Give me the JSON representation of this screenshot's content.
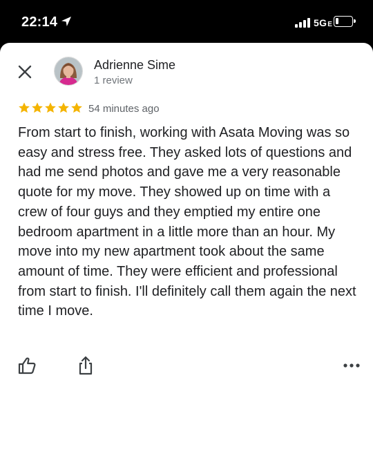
{
  "status_bar": {
    "time": "22:14",
    "network": "5G",
    "network_suffix": "E",
    "battery_level": 0.18
  },
  "review": {
    "author": "Adrienne Sime",
    "review_count": "1 review",
    "rating": 5,
    "time_ago": "54 minutes ago",
    "text": "From start to finish, working with Asata Moving was so easy and stress free. They asked lots of questions and had me send photos and gave me a very reasonable quote for my move. They showed up on time with a crew of four guys and they emptied my entire one bedroom apartment in a little more than an hour. My move into my new apartment took about the same amount of time. They were efficient and professional from start to finish. I'll definitely call them again the next time I move."
  },
  "colors": {
    "star": "#f4b400",
    "text": "#202124",
    "secondary_text": "#70757a",
    "icon": "#3c4043"
  },
  "icons": {
    "close": "close-icon",
    "like": "thumbs-up-icon",
    "share": "share-icon",
    "more": "more-horizontal-icon"
  }
}
